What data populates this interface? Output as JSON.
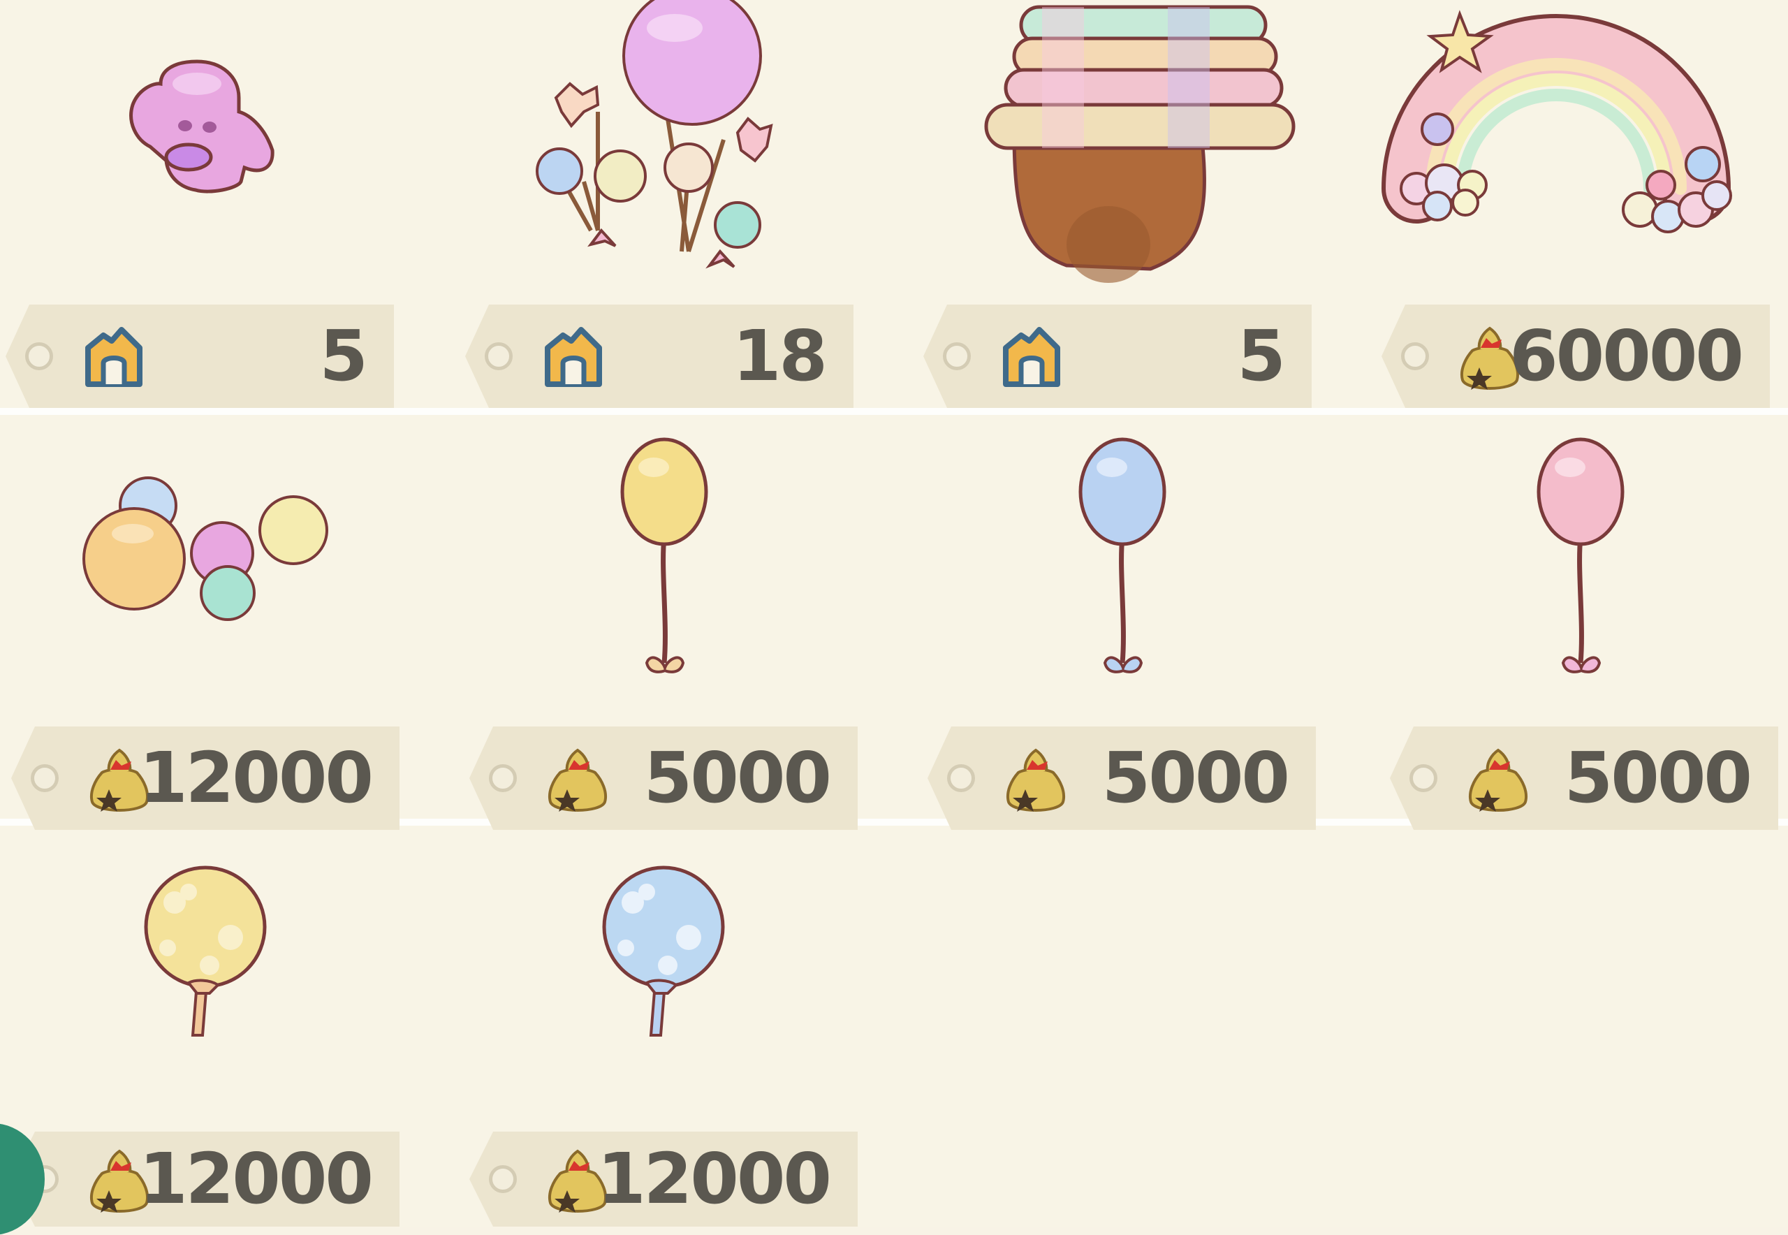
{
  "colors": {
    "background": "#f8f4e6",
    "price_tag": "#ece5cf",
    "price_text": "#5b5850"
  },
  "rows": [
    {
      "items": [
        {
          "name": "ghost-item",
          "currency": "nook-miles",
          "price": "5"
        },
        {
          "name": "balloon-bouquet-item",
          "currency": "nook-miles",
          "price": "18"
        },
        {
          "name": "pastel-cake-pot-item",
          "currency": "nook-miles",
          "price": "5"
        },
        {
          "name": "rainbow-arch-item",
          "currency": "bells",
          "price": "60000"
        }
      ]
    },
    {
      "items": [
        {
          "name": "bubble-cluster-item",
          "currency": "bells",
          "price": "12000"
        },
        {
          "name": "yellow-balloon-item",
          "currency": "bells",
          "price": "5000"
        },
        {
          "name": "blue-balloon-item",
          "currency": "bells",
          "price": "5000"
        },
        {
          "name": "pink-balloon-item",
          "currency": "bells",
          "price": "5000"
        }
      ]
    },
    {
      "items": [
        {
          "name": "yellow-flower-balloon-item",
          "currency": "bells",
          "price": "12000"
        },
        {
          "name": "blue-flower-balloon-item",
          "currency": "bells",
          "price": "12000"
        }
      ]
    }
  ],
  "icons": {
    "nook_miles": "nook-miles-icon",
    "bells": "bell-bag-icon",
    "tag_hole": "tag-hole-icon"
  }
}
